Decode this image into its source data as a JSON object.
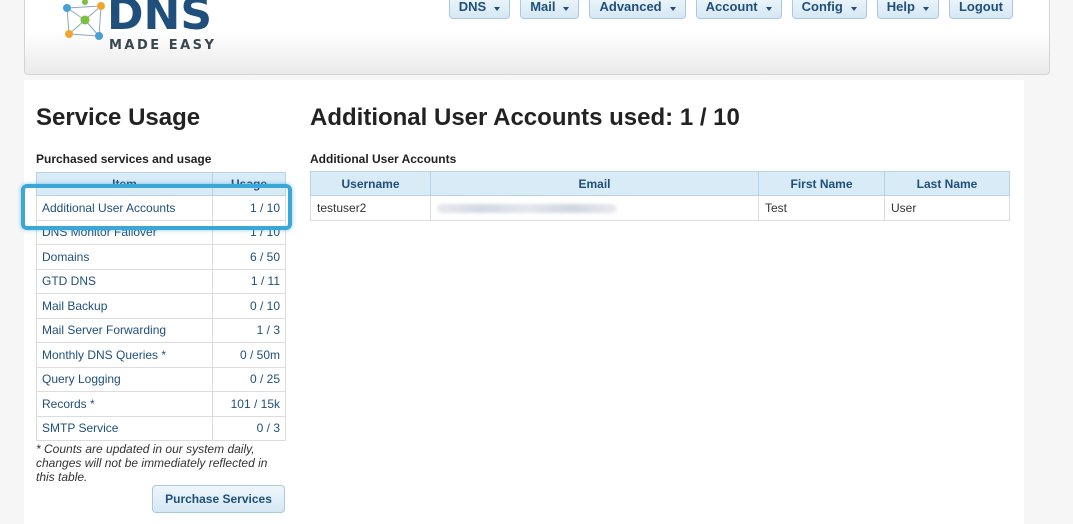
{
  "logo": {
    "name": "DNS",
    "tagline": "MADE EASY"
  },
  "nav": [
    {
      "label": "DNS",
      "dropdown": true
    },
    {
      "label": "Mail",
      "dropdown": true
    },
    {
      "label": "Advanced",
      "dropdown": true
    },
    {
      "label": "Account",
      "dropdown": true
    },
    {
      "label": "Config",
      "dropdown": true
    },
    {
      "label": "Help",
      "dropdown": true
    },
    {
      "label": "Logout",
      "dropdown": false
    }
  ],
  "left": {
    "title": "Service Usage",
    "section_label": "Purchased services and usage",
    "columns": [
      "Item",
      "Usage"
    ],
    "rows": [
      {
        "item": "Additional User Accounts",
        "usage": "1 / 10"
      },
      {
        "item": "DNS Monitor Failover",
        "usage": "1 / 10"
      },
      {
        "item": "Domains",
        "usage": "6 / 50"
      },
      {
        "item": "GTD DNS",
        "usage": "1 / 11"
      },
      {
        "item": "Mail Backup",
        "usage": "0 / 10"
      },
      {
        "item": "Mail Server Forwarding",
        "usage": "1 / 3"
      },
      {
        "item": "Monthly DNS Queries *",
        "usage": "0 / 50m"
      },
      {
        "item": "Query Logging",
        "usage": "0 / 25"
      },
      {
        "item": "Records *",
        "usage": "101 / 15k"
      },
      {
        "item": "SMTP Service",
        "usage": "0 / 3"
      }
    ],
    "note": "* Counts are updated in our system daily, changes will not be immediately reflected in this table.",
    "purchase_label": "Purchase Services"
  },
  "right": {
    "title": "Additional User Accounts used: 1 / 10",
    "section_label": "Additional User Accounts",
    "columns": [
      "Username",
      "Email",
      "First Name",
      "Last Name"
    ],
    "rows": [
      {
        "username": "testuser2",
        "first_name": "Test",
        "last_name": "User"
      }
    ]
  },
  "colors": {
    "brand": "#1f4f7a",
    "header_cell": "#d8ebf7",
    "highlight": "#3aa7d8"
  }
}
